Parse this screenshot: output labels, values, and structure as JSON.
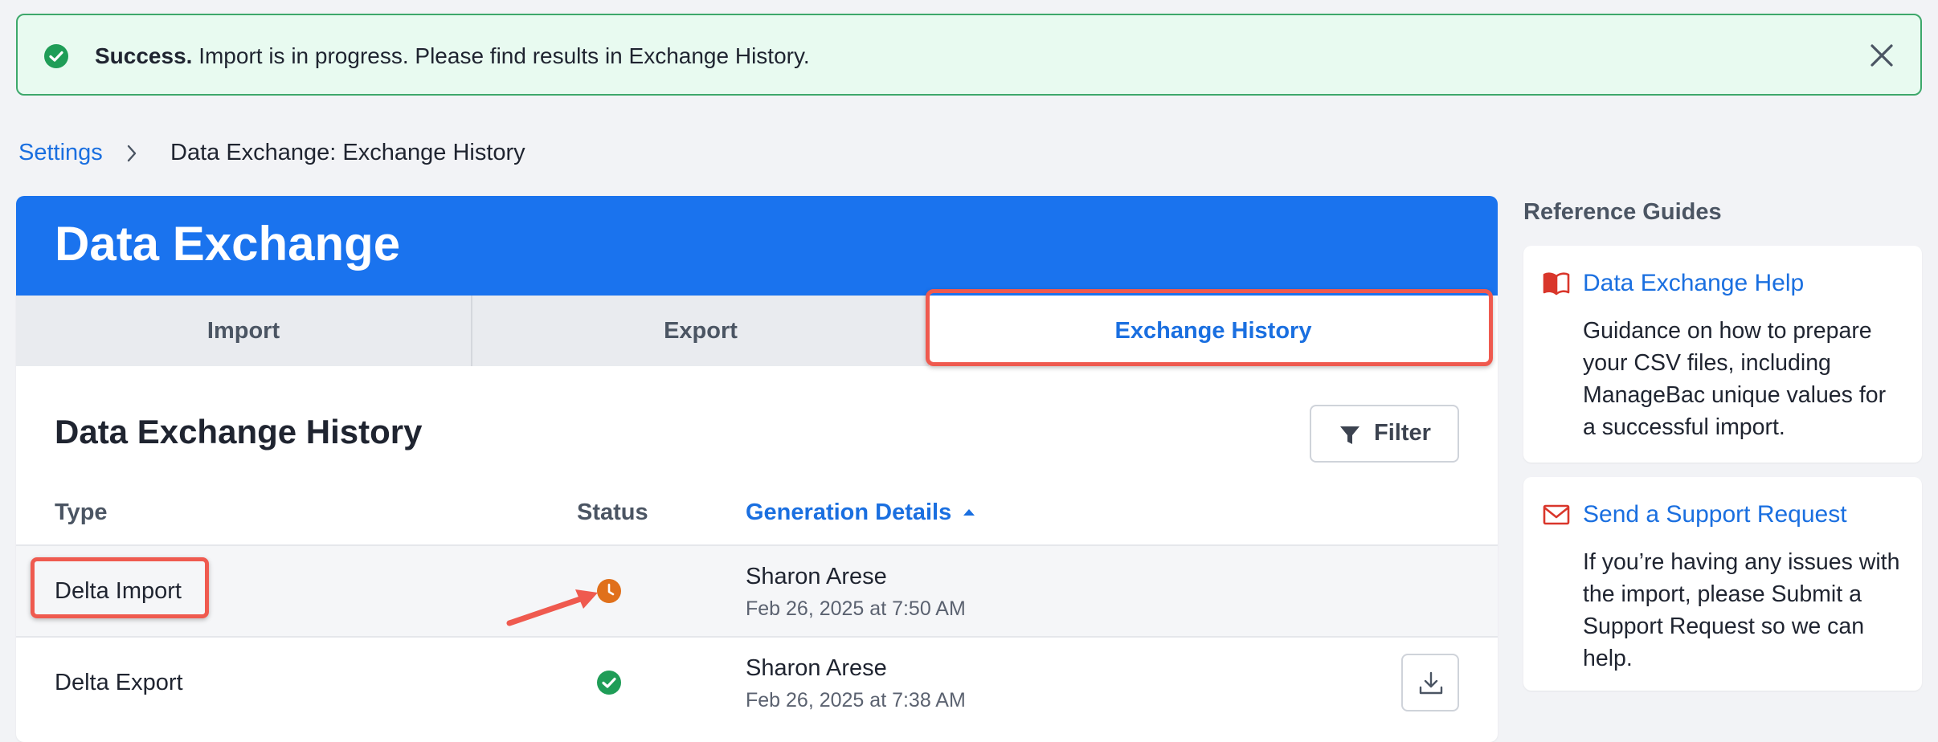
{
  "banner": {
    "strong": "Success.",
    "message": " Import is in progress. Please find results in Exchange History."
  },
  "breadcrumb": {
    "parent": "Settings",
    "current": "Data Exchange: Exchange History"
  },
  "card": {
    "title": "Data Exchange",
    "tabs": [
      {
        "label": "Import"
      },
      {
        "label": "Export"
      },
      {
        "label": "Exchange History",
        "active": true
      }
    ],
    "section_title": "Data Exchange History",
    "filter_label": "Filter",
    "columns": {
      "type": "Type",
      "status": "Status",
      "generation": "Generation Details"
    },
    "rows": [
      {
        "type": "Delta Import",
        "status": "in-progress",
        "name": "Sharon Arese",
        "date": "Feb 26, 2025 at 7:50 AM"
      },
      {
        "type": "Delta Export",
        "status": "completed",
        "name": "Sharon Arese",
        "date": "Feb 26, 2025 at 7:38 AM"
      }
    ]
  },
  "sidebar": {
    "title": "Reference Guides",
    "guides": [
      {
        "icon": "book-icon",
        "link": "Data Exchange Help",
        "text": "Guidance on how to prepare your CSV files, including ManageBac unique values for a successful import."
      },
      {
        "icon": "envelope-icon",
        "link": "Send a Support Request",
        "text": "If you’re having any issues with the import, please Submit a Support Request so we can help."
      }
    ]
  },
  "colors": {
    "accent": "#1a73ee",
    "success": "#1f9d57",
    "pending": "#e0701b",
    "highlight": "#ef5a4f"
  }
}
